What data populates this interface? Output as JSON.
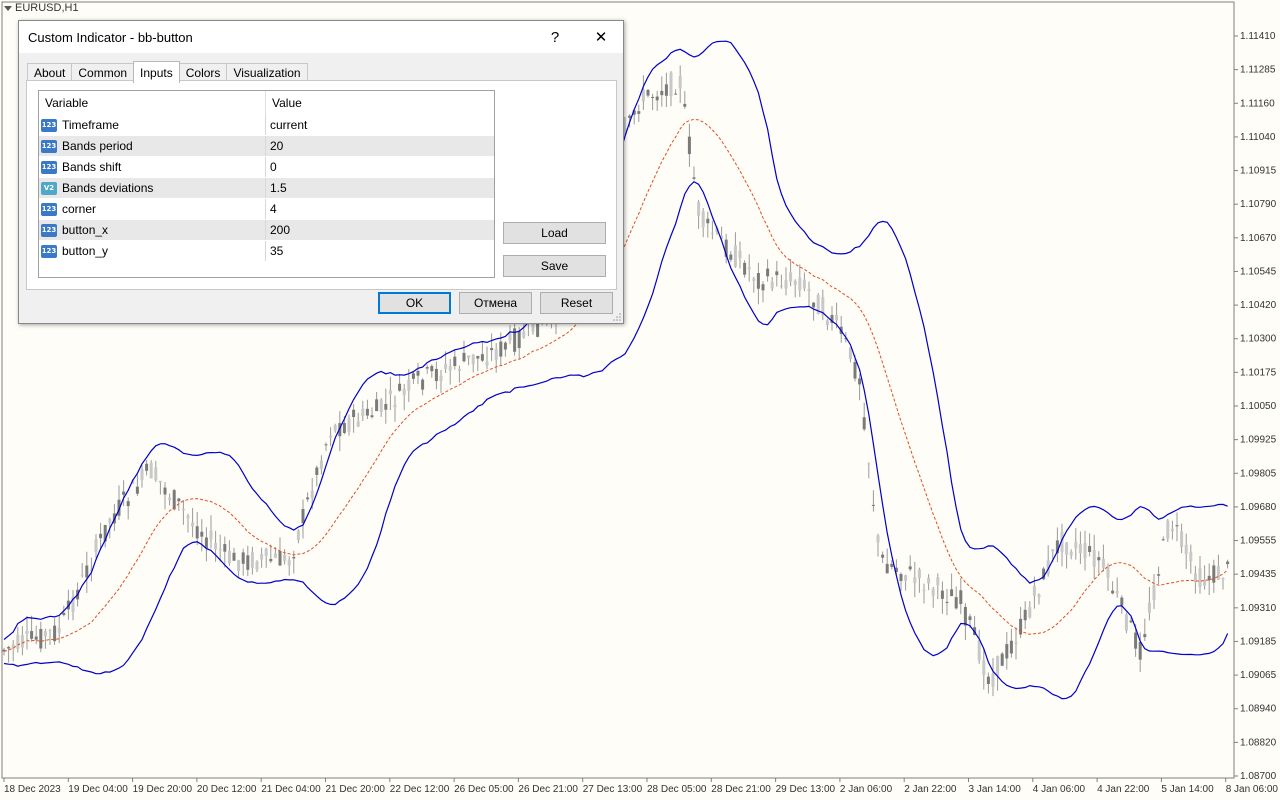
{
  "chart": {
    "symbol": "EURUSD,H1",
    "colors": {
      "candle": "#7a7a7a",
      "band": "#0000c8",
      "middle": "#e0501e",
      "background": "#fefdf8",
      "axis": "#808080"
    },
    "price_ticks": [
      "1.11410",
      "1.11285",
      "1.11160",
      "1.11040",
      "1.10915",
      "1.10790",
      "1.10670",
      "1.10545",
      "1.10420",
      "1.10300",
      "1.10175",
      "1.10050",
      "1.09925",
      "1.09805",
      "1.09680",
      "1.09555",
      "1.09435",
      "1.09310",
      "1.09185",
      "1.09065",
      "1.08940",
      "1.08820",
      "1.08700"
    ],
    "time_ticks": [
      "18 Dec 2023",
      "19 Dec 04:00",
      "19 Dec 20:00",
      "20 Dec 12:00",
      "21 Dec 04:00",
      "21 Dec 20:00",
      "22 Dec 12:00",
      "26 Dec 05:00",
      "26 Dec 21:00",
      "27 Dec 13:00",
      "28 Dec 05:00",
      "28 Dec 21:00",
      "29 Dec 13:00",
      "2 Jan 06:00",
      "2 Jan 22:00",
      "3 Jan 14:00",
      "4 Jan 06:00",
      "4 Jan 22:00",
      "5 Jan 14:00",
      "8 Jan 06:00"
    ]
  },
  "dialog": {
    "title": "Custom Indicator - bb-button",
    "help_label": "?",
    "close_label": "✕",
    "tabs": [
      "About",
      "Common",
      "Inputs",
      "Colors",
      "Visualization"
    ],
    "active_tab": "Inputs",
    "columns": {
      "variable": "Variable",
      "value": "Value"
    },
    "rows": [
      {
        "type": "123",
        "variable": "Timeframe",
        "value": "current"
      },
      {
        "type": "123",
        "variable": "Bands period",
        "value": "20"
      },
      {
        "type": "123",
        "variable": "Bands shift",
        "value": "0"
      },
      {
        "type": "V2",
        "variable": "Bands deviations",
        "value": "1.5"
      },
      {
        "type": "123",
        "variable": "corner",
        "value": "4"
      },
      {
        "type": "123",
        "variable": "button_x",
        "value": "200"
      },
      {
        "type": "123",
        "variable": "button_y",
        "value": "35"
      }
    ],
    "load_label": "Load",
    "save_label": "Save",
    "ok_label": "OK",
    "cancel_label": "Отмена",
    "reset_label": "Reset"
  }
}
